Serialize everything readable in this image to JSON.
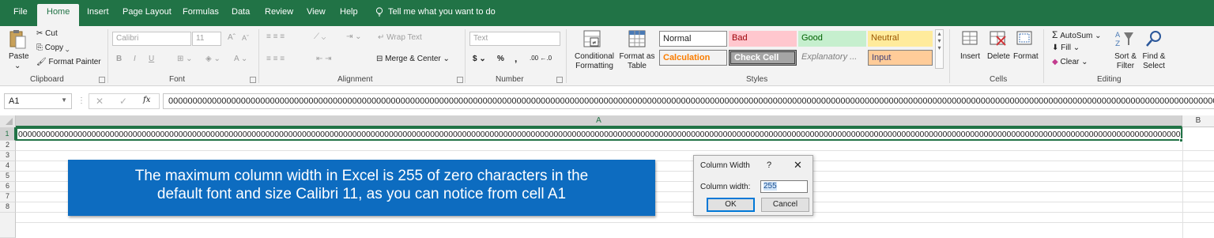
{
  "menu": {
    "items": [
      "File",
      "Home",
      "Insert",
      "Page Layout",
      "Formulas",
      "Data",
      "Review",
      "View",
      "Help"
    ],
    "tell_me": "Tell me what you want to do"
  },
  "ribbon": {
    "clipboard": {
      "paste": "Paste",
      "cut": "Cut",
      "copy": "Copy",
      "format_painter": "Format Painter",
      "label": "Clipboard"
    },
    "font": {
      "name": "Calibri",
      "size": "11",
      "bold": "B",
      "italic": "I",
      "underline": "U",
      "grow": "A",
      "shrink": "A",
      "color_a": "A",
      "label": "Font"
    },
    "alignment": {
      "wrap": "Wrap Text",
      "merge": "Merge & Center",
      "label": "Alignment"
    },
    "number": {
      "format": "Text",
      "currency": "$",
      "percent": "%",
      "comma": ",",
      "inc": ".00 ←.0",
      "label": "Number"
    },
    "styles": {
      "conditional": "Conditional Formatting",
      "format_as_table": "Format as Table",
      "cells": [
        "Normal",
        "Bad",
        "Good",
        "Neutral",
        "Calculation",
        "Check Cell",
        "Explanatory ...",
        "Input"
      ],
      "label": "Styles"
    },
    "cells": {
      "insert": "Insert",
      "delete": "Delete",
      "format": "Format",
      "label": "Cells"
    },
    "editing": {
      "autosum": "AutoSum",
      "fill": "Fill",
      "clear": "Clear",
      "sort": "Sort & Filter",
      "find": "Find & Select",
      "label": "Editing"
    },
    "colors": {
      "bad_bg": "#ffc7ce",
      "bad_fg": "#9c0006",
      "good_bg": "#c6efce",
      "good_fg": "#006100",
      "neutral_bg": "#ffeb9c",
      "neutral_fg": "#9c5700",
      "calc_fg": "#fa7d00",
      "input_bg": "#ffcc99",
      "check_bg": "#a5a5a5"
    }
  },
  "formula_bar": {
    "name_box": "A1",
    "cancel": "✕",
    "enter": "✓",
    "fx": "fx",
    "content": "000000000000000000000000000000000000000000000000000000000000000000000000000000000000000000000000000000000000000000000000000000000000000000000000000000000000000000000000000000000000000000000000000000000000000000000000000000000000000000000000000000000000000"
  },
  "sheet": {
    "columns": [
      "A",
      "B"
    ],
    "rows": [
      "1",
      "2",
      "3",
      "4",
      "5",
      "6",
      "7",
      "8"
    ],
    "a1": "000000000000000000000000000000000000000000000000000000000000000000000000000000000000000000000000000000000000000000000000000000000000000000000000000000000000000000000000000000000000000000000000000000000000000000000000000000000000000000000000000000000000000"
  },
  "callout": {
    "line1": "The maximum column width in Excel is 255 of zero characters in the",
    "line2": "default font and size Calibri 11, as you can notice from cell A1"
  },
  "dialog": {
    "title": "Column Width",
    "help": "?",
    "close": "✕",
    "label": "Column width:",
    "value": "255",
    "ok": "OK",
    "cancel": "Cancel"
  }
}
